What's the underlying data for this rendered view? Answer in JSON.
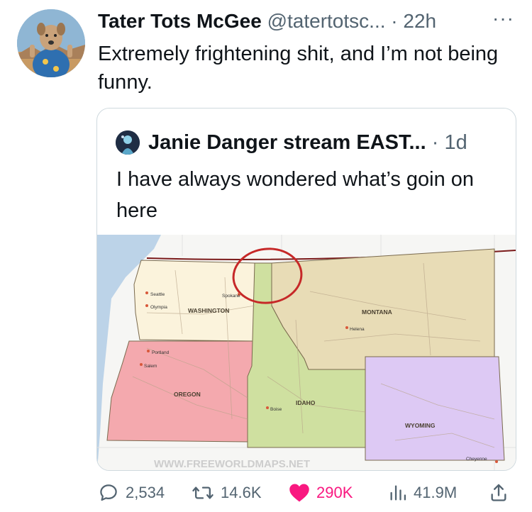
{
  "tweet": {
    "author_name": "Tater Tots McGee",
    "handle": "@tatertotsc...",
    "separator": "·",
    "time": "22h",
    "more": "···",
    "text": "Extremely frightening shit, and I’m not being funny."
  },
  "quoted": {
    "author_name": "Janie Danger stream EAST...",
    "separator": "·",
    "time": "1d",
    "text": "I have always wondered what’s goin on here",
    "map": {
      "states": [
        "WASHINGTON",
        "OREGON",
        "IDAHO",
        "MONTANA",
        "WYOMING"
      ],
      "cities": [
        "Seattle",
        "Olympia",
        "Spokane",
        "Portland",
        "Salem",
        "Boise",
        "Helena",
        "Cheyenne"
      ],
      "watermark": "WWW.FREEWORLDMAPS.NET",
      "colors": {
        "washington": "#fbf3dc",
        "oregon": "#f4a9ae",
        "idaho": "#cfe0a0",
        "montana": "#e8dcb6",
        "wyoming": "#ddc9f4",
        "water": "#bcd3e8",
        "circle": "#c62828"
      }
    }
  },
  "actions": {
    "replies": "2,534",
    "retweets": "14.6K",
    "likes": "290K",
    "views": "41.9M"
  },
  "colors": {
    "text": "#0f1419",
    "muted": "#536471",
    "like": "#f91880",
    "border": "#cfd9de"
  }
}
